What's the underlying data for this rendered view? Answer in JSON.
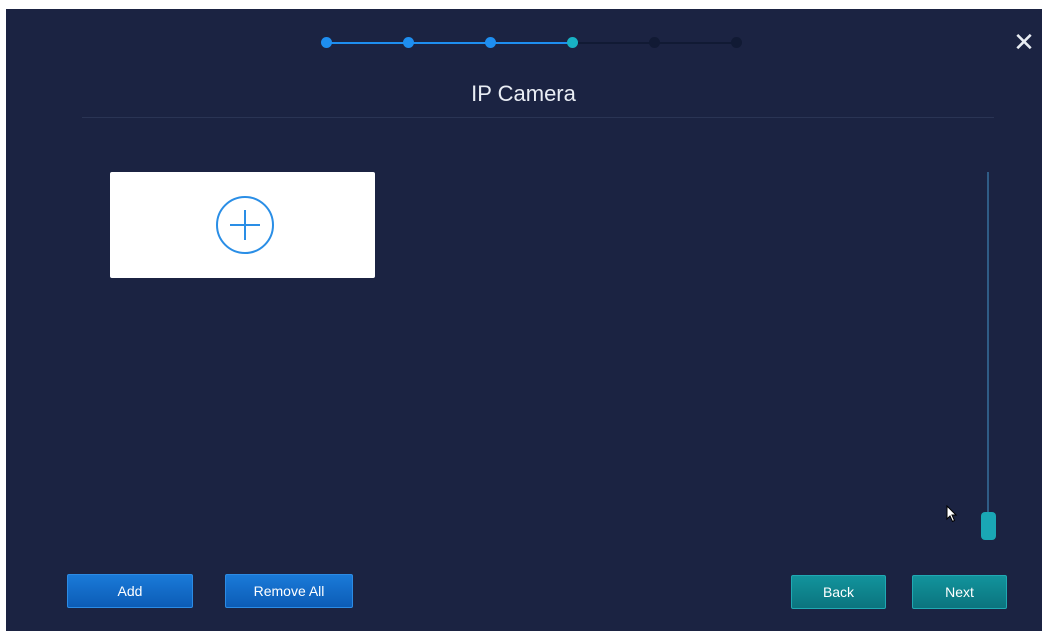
{
  "wizard": {
    "title": "IP Camera",
    "total_steps": 6,
    "current_step": 4
  },
  "colors": {
    "background": "#1b2342",
    "step_done": "#1e8ef0",
    "step_current": "#18b2c4",
    "step_pending": "#111a34",
    "button_blue": "#0f6bc8",
    "button_teal": "#0f858f"
  },
  "icons": {
    "close": "close-icon",
    "add": "plus-circle-icon",
    "cursor": "mouse-pointer-icon"
  },
  "buttons": {
    "add": "Add",
    "remove_all": "Remove All",
    "back": "Back",
    "next": "Next"
  },
  "scrollbar": {
    "position": 1.0
  }
}
